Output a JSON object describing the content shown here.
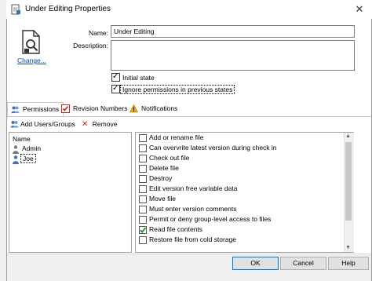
{
  "dialog": {
    "title": "Under Editing Properties"
  },
  "change_link": "Change...",
  "fields": {
    "name_label": "Name:",
    "name_value": "Under Editing",
    "description_label": "Description:",
    "description_value": ""
  },
  "checkboxes": [
    {
      "label": "Initial state",
      "checked": true
    },
    {
      "label": "Ignore permissions in previous states",
      "checked": true
    }
  ],
  "tabs": [
    {
      "label": "Permissions",
      "selected": true
    },
    {
      "label": "Revision Numbers",
      "selected": false
    },
    {
      "label": "Notifications",
      "selected": false
    }
  ],
  "toolbar": {
    "add_label": "Add Users/Groups",
    "remove_label": "Remove"
  },
  "users": {
    "header": "Name",
    "items": [
      {
        "label": "Admin",
        "selected": false
      },
      {
        "label": "Joe",
        "selected": true
      }
    ]
  },
  "permissions": [
    {
      "label": "Add or rename file",
      "checked": false
    },
    {
      "label": "Can overvrite latest version during check in",
      "checked": false
    },
    {
      "label": "Check out file",
      "checked": false
    },
    {
      "label": "Delete file",
      "checked": false
    },
    {
      "label": "Destroy",
      "checked": false
    },
    {
      "label": "Edit version free variable data",
      "checked": false
    },
    {
      "label": "Move file",
      "checked": false
    },
    {
      "label": "Must enter version comments",
      "checked": false
    },
    {
      "label": "Permit or deny group-level access to files",
      "checked": false
    },
    {
      "label": "Read file contents",
      "checked": true
    },
    {
      "label": "Restore file from cold storage",
      "checked": false
    }
  ],
  "buttons": {
    "ok": "OK",
    "cancel": "Cancel",
    "help": "Help"
  },
  "colors": {
    "link": "#0645ad",
    "check_green": "#1f8f2a",
    "revision_red": "#c42b1c",
    "warning_yellow": "#f0b400",
    "user_blue": "#3a6fc4",
    "ok_border": "#0078d7"
  }
}
